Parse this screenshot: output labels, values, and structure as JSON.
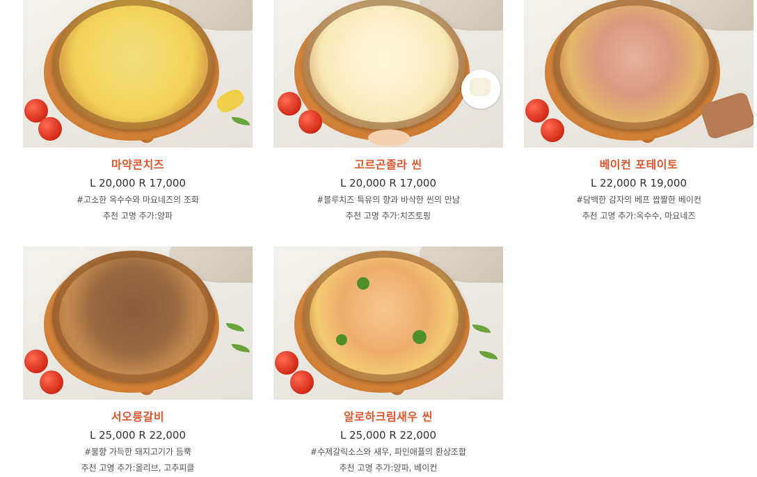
{
  "menu": {
    "items": [
      {
        "name": "마약콘치즈",
        "price": "L 20,000 R 17,000",
        "desc": "#고소한 옥수수와 마요네즈의 조화",
        "rec": "추천 고명 추가:양파",
        "image": "corn-cheese-pizza-photo"
      },
      {
        "name": "고르곤졸라 씬",
        "price": "L 20,000 R 17,000",
        "desc": "#블루치즈 특유의 향과 바삭한 씬의 만남",
        "rec": "추천 고명 추가:치즈토핑",
        "image": "gorgonzola-thin-pizza-photo"
      },
      {
        "name": "베이컨 포테이토",
        "price": "L 22,000 R 19,000",
        "desc": "#담백한 감자의 베프 짭짤한 베이컨",
        "rec": "추천 고명 추가:옥수수, 마요네즈",
        "image": "bacon-potato-pizza-photo"
      },
      {
        "name": "서오릉갈비",
        "price": "L 25,000 R 22,000",
        "desc": "#불향 가득한 돼지고기가 듬뿍",
        "rec": "추천 고명 추가:올리브, 고추피클",
        "image": "galbi-pizza-photo"
      },
      {
        "name": "알로하크림새우 씬",
        "price": "L 25,000 R 22,000",
        "desc": "#수제갈릭소스와 새우, 파인애플의 환상조합",
        "rec": "추천 고명 추가:양파, 베이컨",
        "image": "aloha-cream-shrimp-pizza-photo"
      }
    ]
  },
  "colors": {
    "title": "#e0542c",
    "price": "#333333",
    "text": "#555555"
  }
}
